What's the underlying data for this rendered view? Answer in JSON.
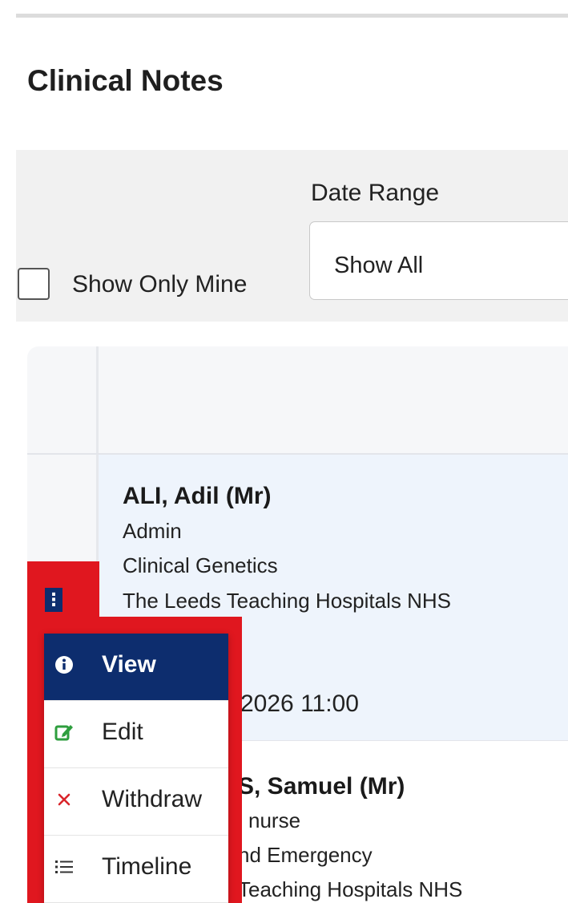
{
  "page": {
    "title": "Clinical Notes"
  },
  "filters": {
    "date_range_label": "Date Range",
    "date_range_value": "Show All",
    "show_only_mine_label": "Show Only Mine",
    "show_only_mine_checked": false
  },
  "rows": [
    {
      "name": "ALI, Adil (Mr)",
      "role": "Admin",
      "department": "Clinical Genetics",
      "organisation": "The Leeds Teaching Hospitals NHS",
      "datetime": "2026 11:00"
    },
    {
      "name": "S, Samuel (Mr)",
      "role": "l nurse",
      "department": "nd Emergency",
      "organisation": "Teaching Hospitals NHS"
    }
  ],
  "row_menu": {
    "items": [
      {
        "label": "View",
        "icon": "info-circle-icon",
        "active": true
      },
      {
        "label": "Edit",
        "icon": "edit-icon",
        "color": "#2e9e3e"
      },
      {
        "label": "Withdraw",
        "icon": "close-icon",
        "color": "#d9252b"
      },
      {
        "label": "Timeline",
        "icon": "list-icon",
        "color": "#333333"
      }
    ]
  },
  "colors": {
    "primary": "#0d2d6e",
    "highlight": "#e0171f",
    "edit": "#2e9e3e",
    "withdraw": "#d9252b"
  }
}
